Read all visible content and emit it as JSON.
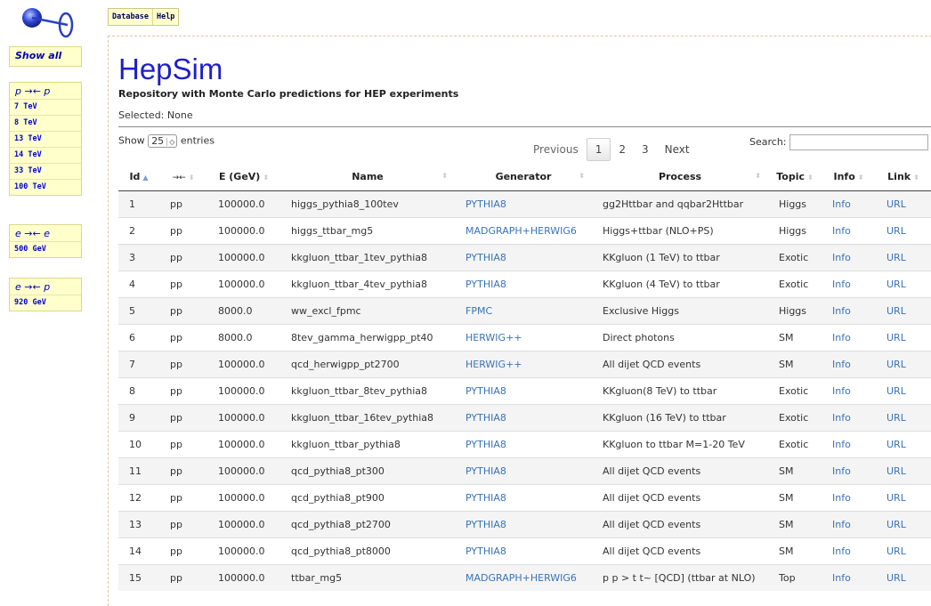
{
  "sidebar": {
    "show_all": "Show all",
    "groups": [
      {
        "title": "p →← p",
        "items": [
          "7 TeV",
          "8 TeV",
          "13 TeV",
          "14 TeV",
          "33 TeV",
          "100 TeV"
        ]
      },
      {
        "title": "e →← e",
        "items": [
          "500 GeV"
        ]
      },
      {
        "title": "e →← p",
        "items": [
          "920 GeV"
        ]
      }
    ]
  },
  "menu": {
    "database": "Database",
    "help": "Help"
  },
  "header": {
    "title": "HepSim",
    "subtitle": "Repository with Monte Carlo predictions for HEP experiments",
    "selected": "Selected: None"
  },
  "controls": {
    "show_label": "Show",
    "entries_value": "25",
    "entries_label": "entries",
    "previous": "Previous",
    "pages": [
      "1",
      "2",
      "3"
    ],
    "next": "Next",
    "search_label": "Search:",
    "search_value": ""
  },
  "table": {
    "columns": [
      "Id",
      "→←",
      "E (GeV)",
      "Name",
      "Generator",
      "Process",
      "Topic",
      "Info",
      "Link"
    ],
    "rows": [
      [
        "1",
        "pp",
        "100000.0",
        "higgs_pythia8_100tev",
        "PYTHIA8",
        "gg2Httbar and qqbar2Httbar",
        "Higgs",
        "Info",
        "URL"
      ],
      [
        "2",
        "pp",
        "100000.0",
        "higgs_ttbar_mg5",
        "MADGRAPH+HERWIG6",
        "Higgs+ttbar (NLO+PS)",
        "Higgs",
        "Info",
        "URL"
      ],
      [
        "3",
        "pp",
        "100000.0",
        "kkgluon_ttbar_1tev_pythia8",
        "PYTHIA8",
        "KKgluon (1 TeV) to ttbar",
        "Exotic",
        "Info",
        "URL"
      ],
      [
        "4",
        "pp",
        "100000.0",
        "kkgluon_ttbar_4tev_pythia8",
        "PYTHIA8",
        "KKgluon (4 TeV) to ttbar",
        "Exotic",
        "Info",
        "URL"
      ],
      [
        "5",
        "pp",
        "8000.0",
        "ww_excl_fpmc",
        "FPMC",
        "Exclusive Higgs",
        "Higgs",
        "Info",
        "URL"
      ],
      [
        "6",
        "pp",
        "8000.0",
        "8tev_gamma_herwigpp_pt40",
        "HERWIG++",
        "Direct photons",
        "SM",
        "Info",
        "URL"
      ],
      [
        "7",
        "pp",
        "100000.0",
        "qcd_herwigpp_pt2700",
        "HERWIG++",
        "All dijet QCD events",
        "SM",
        "Info",
        "URL"
      ],
      [
        "8",
        "pp",
        "100000.0",
        "kkgluon_ttbar_8tev_pythia8",
        "PYTHIA8",
        "KKgluon(8 TeV) to ttbar",
        "Exotic",
        "Info",
        "URL"
      ],
      [
        "9",
        "pp",
        "100000.0",
        "kkgluon_ttbar_16tev_pythia8",
        "PYTHIA8",
        "KKgluon (16 TeV) to ttbar",
        "Exotic",
        "Info",
        "URL"
      ],
      [
        "10",
        "pp",
        "100000.0",
        "kkgluon_ttbar_pythia8",
        "PYTHIA8",
        "KKgluon to ttbar M=1-20 TeV",
        "Exotic",
        "Info",
        "URL"
      ],
      [
        "11",
        "pp",
        "100000.0",
        "qcd_pythia8_pt300",
        "PYTHIA8",
        "All dijet QCD events",
        "SM",
        "Info",
        "URL"
      ],
      [
        "12",
        "pp",
        "100000.0",
        "qcd_pythia8_pt900",
        "PYTHIA8",
        "All dijet QCD events",
        "SM",
        "Info",
        "URL"
      ],
      [
        "13",
        "pp",
        "100000.0",
        "qcd_pythia8_pt2700",
        "PYTHIA8",
        "All dijet QCD events",
        "SM",
        "Info",
        "URL"
      ],
      [
        "14",
        "pp",
        "100000.0",
        "qcd_pythia8_pt8000",
        "PYTHIA8",
        "All dijet QCD events",
        "SM",
        "Info",
        "URL"
      ],
      [
        "15",
        "pp",
        "100000.0",
        "ttbar_mg5",
        "MADGRAPH+HERWIG6",
        "p p > t t~ [QCD] (ttbar at NLO)",
        "Top",
        "Info",
        "URL"
      ]
    ]
  },
  "colors": {
    "title": "#1f1fc8",
    "link": "#3a73b8",
    "sidebar_bg": "#ffffcc"
  },
  "icons": {
    "logo": "collider-logo-icon",
    "sort": "sort-arrows-icon"
  }
}
